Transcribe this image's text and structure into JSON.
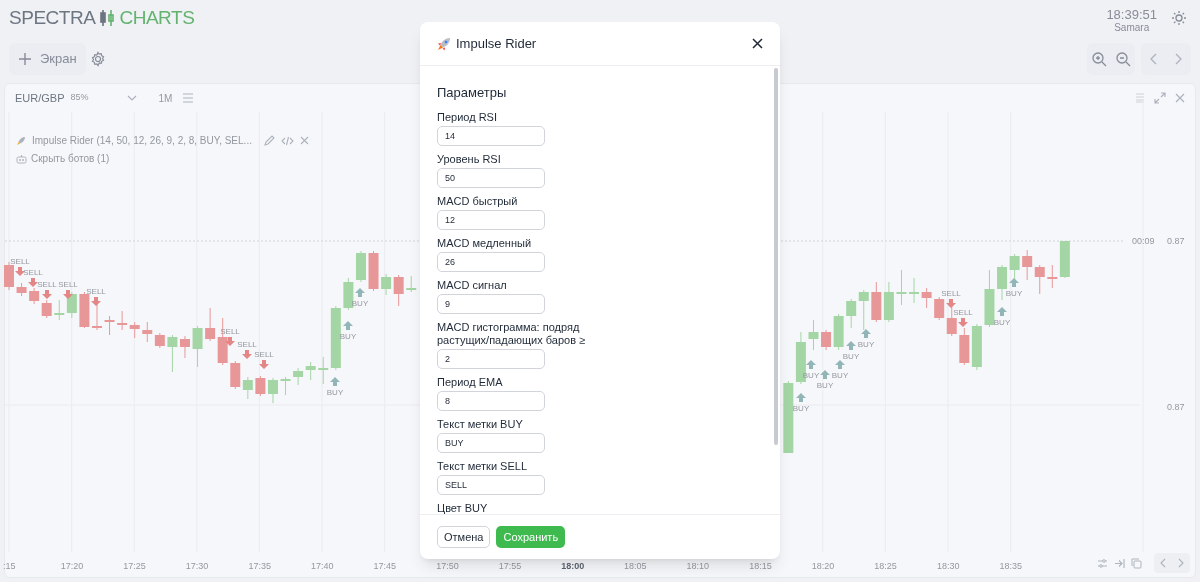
{
  "header": {
    "logo_left": "SPECTRA",
    "logo_right": "CHARTS",
    "clock": "18:39:51",
    "timezone": "Samara"
  },
  "toolbar": {
    "add_screen": "Экран"
  },
  "chart_panel": {
    "symbol": "EUR/GBP",
    "payout": "85%",
    "timeframe": "1M",
    "indicator_legend": "Impulse Rider (14, 50, 12, 26, 9, 2, 8, BUY, SEL...",
    "hide_bots": "Скрыть ботов (1)",
    "countdown": "00:09",
    "price_labels": [
      "0.87",
      "0.87"
    ],
    "signals": [
      {
        "kind": "sell",
        "label": "SELL"
      },
      {
        "kind": "sell",
        "label": "SELL"
      },
      {
        "kind": "sell",
        "label": "SELL"
      },
      {
        "kind": "sell",
        "label": "SELL"
      },
      {
        "kind": "sell",
        "label": "SELL"
      },
      {
        "kind": "sell",
        "label": "SELL"
      },
      {
        "kind": "sell",
        "label": "SELL"
      },
      {
        "kind": "sell",
        "label": "SELL"
      },
      {
        "kind": "buy",
        "label": "BUY"
      },
      {
        "kind": "buy",
        "label": "BUY"
      },
      {
        "kind": "buy",
        "label": "BUY"
      },
      {
        "kind": "buy",
        "label": "BUY"
      },
      {
        "kind": "buy",
        "label": "BUY"
      },
      {
        "kind": "buy",
        "label": "BUY"
      },
      {
        "kind": "buy",
        "label": "BUY"
      },
      {
        "kind": "buy",
        "label": "BUY"
      },
      {
        "kind": "buy",
        "label": "BUY"
      },
      {
        "kind": "sell",
        "label": "SELL"
      },
      {
        "kind": "sell",
        "label": "SELL"
      },
      {
        "kind": "buy",
        "label": "BUY"
      },
      {
        "kind": "buy",
        "label": "BUY"
      }
    ],
    "time_axis": [
      {
        "label": ":15",
        "emphasized": false
      },
      {
        "label": "17:20",
        "emphasized": false
      },
      {
        "label": "17:25",
        "emphasized": false
      },
      {
        "label": "17:30",
        "emphasized": false
      },
      {
        "label": "17:35",
        "emphasized": false
      },
      {
        "label": "17:40",
        "emphasized": false
      },
      {
        "label": "17:45",
        "emphasized": false
      },
      {
        "label": "17:50",
        "emphasized": false
      },
      {
        "label": "17:55",
        "emphasized": false
      },
      {
        "label": "18:00",
        "emphasized": true
      },
      {
        "label": "18:05",
        "emphasized": false
      },
      {
        "label": "18:10",
        "emphasized": false
      },
      {
        "label": "18:15",
        "emphasized": false
      },
      {
        "label": "18:20",
        "emphasized": false
      },
      {
        "label": "18:25",
        "emphasized": false
      },
      {
        "label": "18:30",
        "emphasized": false
      },
      {
        "label": "18:35",
        "emphasized": false
      }
    ]
  },
  "dialog": {
    "title": "Impulse Rider",
    "section": "Параметры",
    "fields": [
      {
        "label": "Период RSI",
        "value": "14"
      },
      {
        "label": "Уровень RSI",
        "value": "50"
      },
      {
        "label": "MACD быстрый",
        "value": "12"
      },
      {
        "label": "MACD медленный",
        "value": "26"
      },
      {
        "label": "MACD сигнал",
        "value": "9"
      },
      {
        "label": "MACD гистограмма: подряд растущих/падающих баров ≥",
        "value": "2"
      },
      {
        "label": "Период EMA",
        "value": "8"
      },
      {
        "label": "Текст метки BUY",
        "value": "BUY"
      },
      {
        "label": "Текст метки SELL",
        "value": "SELL"
      }
    ],
    "cut_label": "Цвет BUY",
    "buttons": [
      {
        "label": "Отмена",
        "kind": "secondary"
      },
      {
        "label": "Сохранить",
        "kind": "primary"
      }
    ]
  }
}
